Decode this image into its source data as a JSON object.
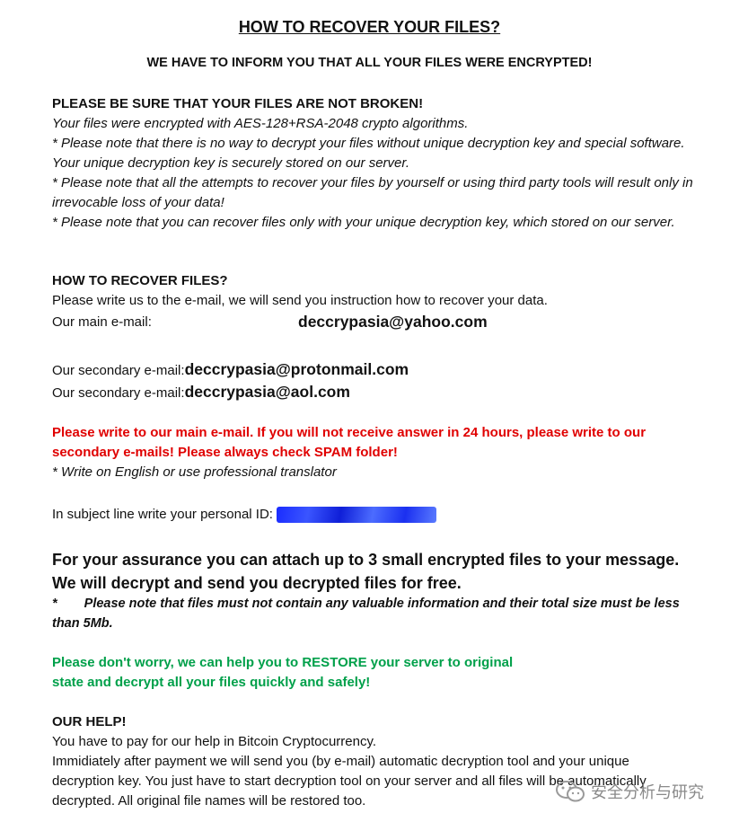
{
  "title": "HOW TO RECOVER YOUR FILES?",
  "subtitle": "WE HAVE TO INFORM YOU THAT ALL YOUR FILES WERE ENCRYPTED!",
  "section1": {
    "heading": "PLEASE BE SURE THAT YOUR FILES ARE NOT BROKEN!",
    "line1": "Your files were encrypted with AES-128+RSA-2048 crypto algorithms.",
    "line2": "* Please note that there is no way to decrypt your files without unique decryption key and special software. Your unique decryption key is securely stored on our server.",
    "line3": "* Please note that all the attempts to recover your files by yourself or using third party tools will result only in irrevocable loss of your data!",
    "line4": "* Please note that you can recover files only with your unique decryption key, which stored on our server."
  },
  "section2": {
    "heading": "HOW TO RECOVER FILES?",
    "line1": "Please write us to the e-mail, we will send you instruction how to recover your data.",
    "main_label": "Our main e-mail:",
    "main_email": "deccrypasia@yahoo.com",
    "secondary_label": "Our secondary e-mail:",
    "secondary_email1": "deccrypasia@protonmail.com",
    "secondary_email2": "deccrypasia@aol.com"
  },
  "warning_red": "Please write to our main e-mail. If you will not receive answer in 24 hours, please write to our secondary e-mails! Please always check SPAM folder!",
  "translator_note": "* Write on English or use professional translator",
  "personal_id_label": "In subject line write your personal ID:",
  "assurance": {
    "line1": "For your assurance you can attach up to 3 small encrypted files to your message.",
    "line2": "We will decrypt and send you decrypted files for free.",
    "note_star": "*",
    "note": "Please note that files must not contain any valuable information and their total size must be less than 5Mb."
  },
  "green_line1": "Please don't worry, we can help you to RESTORE your server to original",
  "green_line2": "state and decrypt all your files quickly and safely!",
  "help": {
    "heading": "OUR HELP!",
    "line1": "You have to pay for our help in Bitcoin Cryptocurrency.",
    "line2": "Immidiately after payment we will send you (by e-mail) automatic decryption tool and your unique decryption key. You just have to start decryption tool on your server and all files will be automatically decrypted. All original file names will be restored too."
  },
  "watermark_text": "安全分析与研究",
  "colors": {
    "red": "#e00000",
    "green": "#00a04a",
    "redaction": "#1a2cff"
  }
}
